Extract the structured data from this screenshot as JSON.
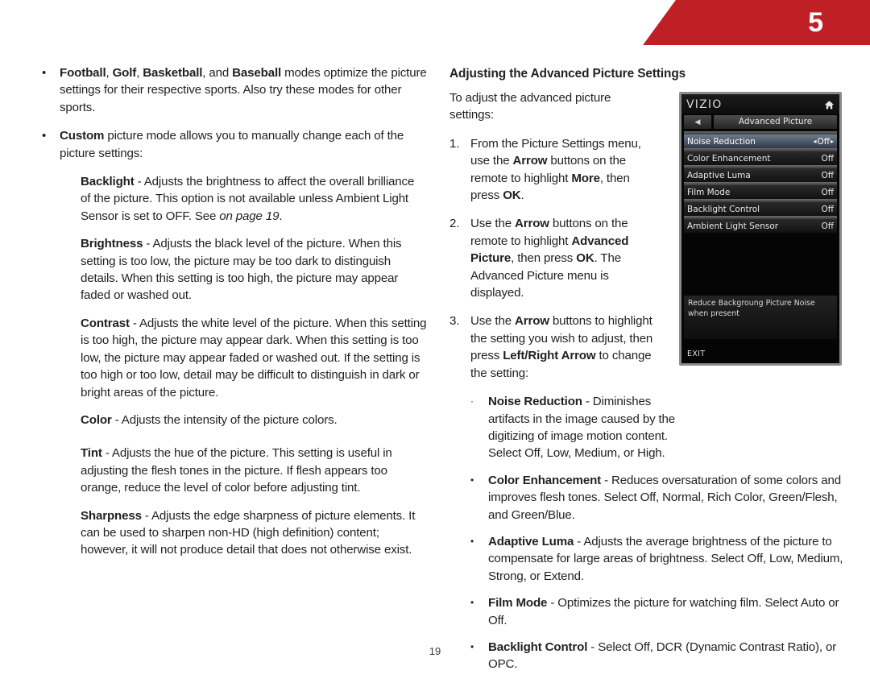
{
  "header": {
    "chapter_number": "5",
    "banner_color": "#bf2026"
  },
  "left_column": {
    "bullets": [
      {
        "mark": "•",
        "segments": [
          {
            "text": "Football",
            "style": "bold"
          },
          {
            "text": ", ",
            "style": "normal"
          },
          {
            "text": "Golf",
            "style": "bold"
          },
          {
            "text": ", ",
            "style": "normal"
          },
          {
            "text": "Basketball",
            "style": "bold"
          },
          {
            "text": ", and ",
            "style": "normal"
          },
          {
            "text": "Baseball",
            "style": "bold"
          },
          {
            "text": " modes optimize the picture settings for their respective sports. Also try these modes for other sports.",
            "style": "normal"
          }
        ]
      },
      {
        "mark": "•",
        "segments": [
          {
            "text": "Custom",
            "style": "bold"
          },
          {
            "text": " picture mode allows you to manually change each of the picture settings:",
            "style": "normal"
          }
        ]
      }
    ],
    "definitions": [
      {
        "segments": [
          {
            "text": "Backlight",
            "style": "bold"
          },
          {
            "text": " - Adjusts the brightness to affect the overall brilliance of the picture. This option is not available unless Ambient Light Sensor is set to OFF. See  ",
            "style": "normal"
          },
          {
            "text": "on page 19",
            "style": "italic"
          },
          {
            "text": ".",
            "style": "normal"
          }
        ]
      },
      {
        "segments": [
          {
            "text": "Brightness",
            "style": "bold"
          },
          {
            "text": " - Adjusts the black level of the picture. When this setting is too low, the picture may be too dark to distinguish details. When this setting is too high, the picture may appear faded or washed out.",
            "style": "normal"
          }
        ]
      },
      {
        "segments": [
          {
            "text": "Contrast",
            "style": "bold"
          },
          {
            "text": " - Adjusts the white level of the picture. When this setting is too high, the picture may appear dark. When this setting is too low, the picture may appear faded or washed out. If the setting is too high or too low, detail may be difficult to distinguish in dark or bright areas of the picture.",
            "style": "normal"
          }
        ]
      },
      {
        "segments": [
          {
            "text": "Color",
            "style": "bold"
          },
          {
            "text": " - Adjusts the intensity of the picture colors.",
            "style": "normal"
          }
        ]
      },
      {
        "segments": [
          {
            "text": "Tint",
            "style": "bold"
          },
          {
            "text": " - Adjusts the hue of the picture. This setting is useful in adjusting the flesh tones in the picture. If flesh appears too orange, reduce the level of color before adjusting tint.",
            "style": "normal"
          }
        ]
      },
      {
        "segments": [
          {
            "text": "Sharpness",
            "style": "bold"
          },
          {
            "text": " - Adjusts the edge sharpness of picture elements. It can be used to sharpen non-HD (high definition) content; however, it will not produce detail that does not otherwise exist.",
            "style": "normal"
          }
        ]
      }
    ]
  },
  "right_column": {
    "heading": "Adjusting the Advanced Picture Settings",
    "intro": "To adjust the advanced picture settings:",
    "steps": [
      {
        "number": "1.",
        "segments": [
          {
            "text": "From the Picture Settings menu, use the ",
            "style": "normal"
          },
          {
            "text": "Arrow",
            "style": "bold"
          },
          {
            "text": " buttons on the remote to highlight ",
            "style": "normal"
          },
          {
            "text": "More",
            "style": "bold"
          },
          {
            "text": ", then press ",
            "style": "normal"
          },
          {
            "text": "OK",
            "style": "bold"
          },
          {
            "text": ".",
            "style": "normal"
          }
        ]
      },
      {
        "number": "2.",
        "segments": [
          {
            "text": "Use the ",
            "style": "normal"
          },
          {
            "text": "Arrow",
            "style": "bold"
          },
          {
            "text": " buttons on the remote to highlight ",
            "style": "normal"
          },
          {
            "text": "Advanced Picture",
            "style": "bold"
          },
          {
            "text": ", then press ",
            "style": "normal"
          },
          {
            "text": "OK",
            "style": "bold"
          },
          {
            "text": ". The Advanced Picture menu is displayed.",
            "style": "normal"
          }
        ]
      },
      {
        "number": "3.",
        "segments": [
          {
            "text": "Use the ",
            "style": "normal"
          },
          {
            "text": "Arrow",
            "style": "bold"
          },
          {
            "text": " buttons to highlight the setting you wish to adjust, then press ",
            "style": "normal"
          },
          {
            "text": "Left/Right Arrow",
            "style": "bold"
          },
          {
            "text": " to change the setting:",
            "style": "normal"
          }
        ]
      }
    ],
    "setting_bullets": [
      {
        "mark": "·",
        "width": "narrow",
        "segments": [
          {
            "text": "Noise Reduction",
            "style": "bold"
          },
          {
            "text": " - Diminishes artifacts in the image caused by the digitizing of image motion content. Select Off, Low, Medium, or High.",
            "style": "normal"
          }
        ]
      },
      {
        "mark": "•",
        "width": "wide",
        "segments": [
          {
            "text": "Color Enhancement",
            "style": "bold"
          },
          {
            "text": " - Reduces oversaturation of some colors and improves flesh tones. Select Off, Normal, Rich Color, Green/Flesh, and Green/Blue.",
            "style": "normal"
          }
        ]
      },
      {
        "mark": "•",
        "width": "wide",
        "segments": [
          {
            "text": "Adaptive Luma",
            "style": "bold"
          },
          {
            "text": " - Adjusts the average brightness of the picture to compensate for large areas of brightness. Select Off, Low, Medium, Strong, or Extend.",
            "style": "normal"
          }
        ]
      },
      {
        "mark": "•",
        "width": "wide",
        "segments": [
          {
            "text": "Film Mode",
            "style": "bold"
          },
          {
            "text": " - Optimizes the picture for watching film. Select Auto or Off.",
            "style": "normal"
          }
        ]
      },
      {
        "mark": "•",
        "width": "wide",
        "segments": [
          {
            "text": "Backlight Control",
            "style": "bold"
          },
          {
            "text": " - Select Off, DCR (Dynamic Contrast Ratio), or OPC.",
            "style": "normal"
          }
        ]
      }
    ]
  },
  "tv_menu": {
    "brand": "VIZIO",
    "title": "Advanced Picture",
    "back_arrow": "◀",
    "left_arrow": "◂",
    "right_arrow": "▸",
    "rows": [
      {
        "label": "Noise Reduction",
        "value": "Off",
        "selected": true
      },
      {
        "label": "Color Enhancement",
        "value": "Off",
        "selected": false
      },
      {
        "label": "Adaptive Luma",
        "value": "Off",
        "selected": false
      },
      {
        "label": "Film Mode",
        "value": "Off",
        "selected": false
      },
      {
        "label": "Backlight Control",
        "value": "Off",
        "selected": false
      },
      {
        "label": "Ambient Light Sensor",
        "value": "Off",
        "selected": false
      }
    ],
    "help_text": "Reduce Backgroung Picture Noise when present",
    "exit_label": "EXIT"
  },
  "footer": {
    "page_number": "19"
  }
}
